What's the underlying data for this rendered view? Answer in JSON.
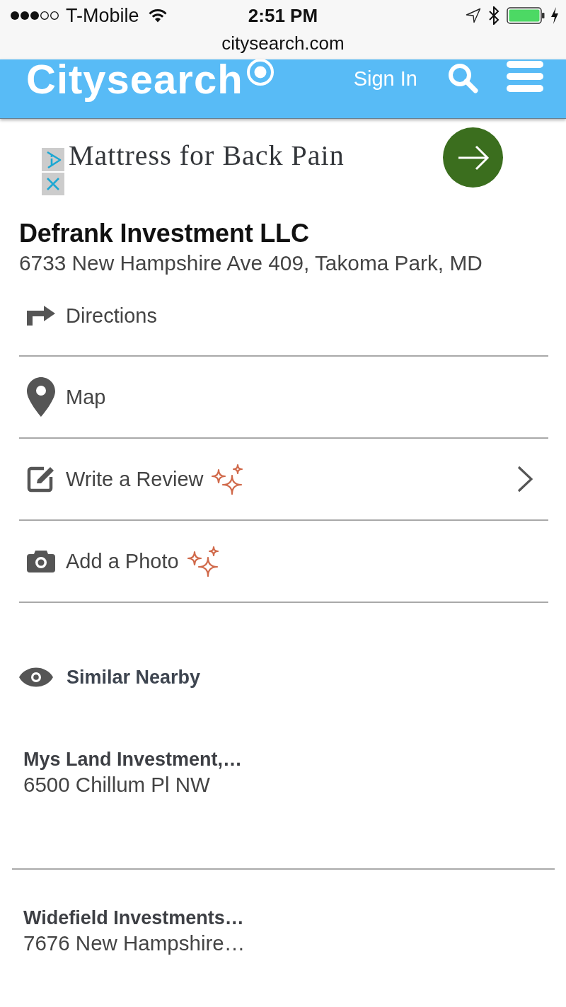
{
  "status_bar": {
    "carrier": "T-Mobile",
    "time": "2:51 PM"
  },
  "address_bar": {
    "url": "citysearch.com"
  },
  "header": {
    "logo": "Citysearch",
    "sign_in": "Sign In"
  },
  "ad": {
    "headline": "Mattress for Back Pain"
  },
  "business": {
    "name": "Defrank Investment LLC",
    "address": "6733 New Hampshire Ave 409, Takoma Park, MD"
  },
  "actions": [
    {
      "kind": "directions",
      "label": "Directions",
      "sparkle": false,
      "chevron": false
    },
    {
      "kind": "map",
      "label": "Map",
      "sparkle": false,
      "chevron": false
    },
    {
      "kind": "review",
      "label": "Write a Review",
      "sparkle": true,
      "chevron": true
    },
    {
      "kind": "photo",
      "label": "Add a Photo",
      "sparkle": true,
      "chevron": false
    }
  ],
  "similar_nearby": {
    "title": "Similar Nearby",
    "items": [
      {
        "name": "Mys Land Investment,…",
        "address": "6500 Chillum Pl NW"
      },
      {
        "name": "Widefield Investments…",
        "address": "7676 New Hampshire…"
      }
    ]
  }
}
